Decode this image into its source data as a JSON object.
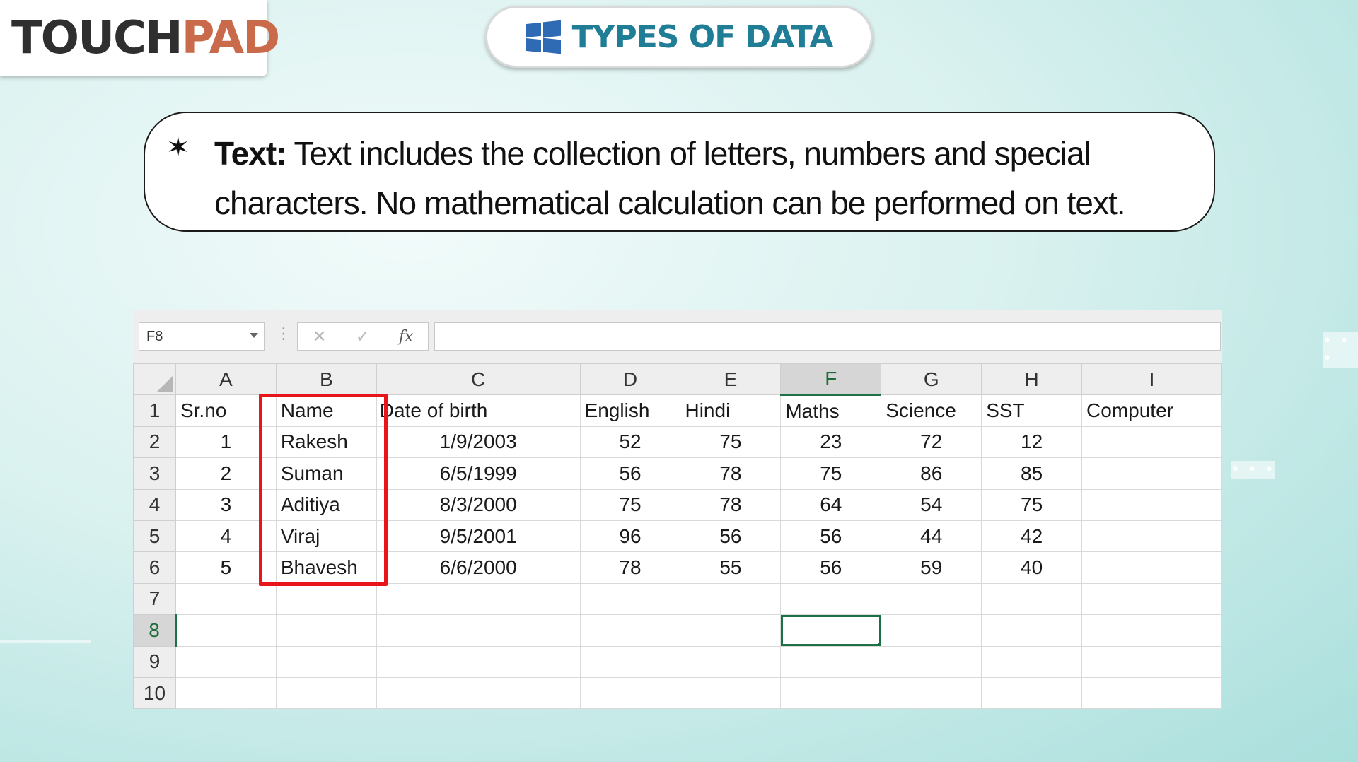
{
  "logo": {
    "part1": "T",
    "o": "O",
    "part2": "UCH",
    "part3": "PAD"
  },
  "title": "TYPES OF DATA",
  "definition": {
    "term": "Text:",
    "body": " Text includes the collection of letters, numbers and special characters. No mathematical calculation can be performed on text."
  },
  "formula_bar": {
    "name_box": "F8",
    "cancel_icon": "✕",
    "enter_icon": "✓",
    "fx_label": "fx",
    "formula": ""
  },
  "sheet": {
    "columns": [
      "A",
      "B",
      "C",
      "D",
      "E",
      "F",
      "G",
      "H",
      "I"
    ],
    "selected_column": "F",
    "selected_row": "8",
    "rows": [
      {
        "n": "1",
        "cells": [
          "Sr.no",
          "Name",
          "Date of birth",
          "English",
          "Hindi",
          "Maths",
          "Science",
          "SST",
          "Computer"
        ]
      },
      {
        "n": "2",
        "cells": [
          "1",
          "Rakesh",
          "1/9/2003",
          "52",
          "75",
          "23",
          "72",
          "12",
          ""
        ]
      },
      {
        "n": "3",
        "cells": [
          "2",
          "Suman",
          "6/5/1999",
          "56",
          "78",
          "75",
          "86",
          "85",
          ""
        ]
      },
      {
        "n": "4",
        "cells": [
          "3",
          "Aditiya",
          "8/3/2000",
          "75",
          "78",
          "64",
          "54",
          "75",
          ""
        ]
      },
      {
        "n": "5",
        "cells": [
          "4",
          "Viraj",
          "9/5/2001",
          "96",
          "56",
          "56",
          "44",
          "42",
          ""
        ]
      },
      {
        "n": "6",
        "cells": [
          "5",
          "Bhavesh",
          "6/6/2000",
          "78",
          "55",
          "56",
          "59",
          "40",
          ""
        ]
      },
      {
        "n": "7",
        "cells": [
          "",
          "",
          "",
          "",
          "",
          "",
          "",
          "",
          ""
        ]
      },
      {
        "n": "8",
        "cells": [
          "",
          "",
          "",
          "",
          "",
          "",
          "",
          "",
          ""
        ]
      },
      {
        "n": "9",
        "cells": [
          "",
          "",
          "",
          "",
          "",
          "",
          "",
          "",
          ""
        ]
      },
      {
        "n": "10",
        "cells": [
          "",
          "",
          "",
          "",
          "",
          "",
          "",
          "",
          ""
        ]
      }
    ]
  },
  "colors": {
    "accent": "#1f7d96",
    "logo_accent": "#c96a4b",
    "highlight": "#e8161b",
    "excel_green": "#1e7145"
  }
}
